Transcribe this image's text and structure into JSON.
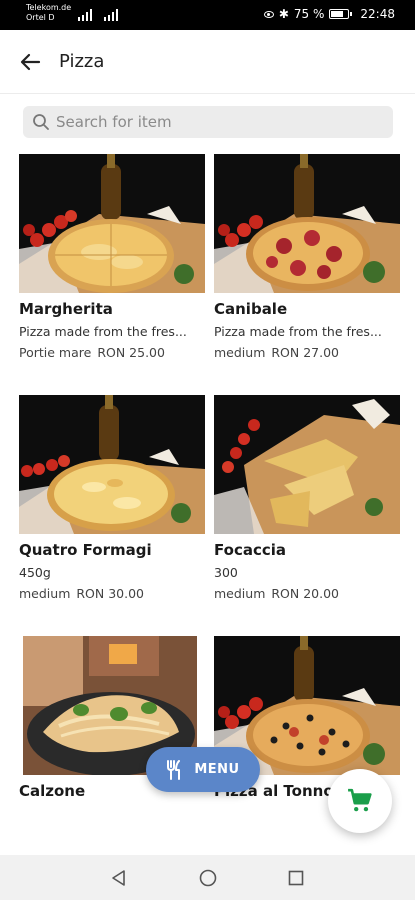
{
  "status_bar": {
    "carrier_line1": "Telekom.de",
    "carrier_line2": "Ortel D",
    "battery": "75 %",
    "time": "22:48"
  },
  "header": {
    "title": "Pizza",
    "back_icon": "arrow-left-icon"
  },
  "search": {
    "placeholder": "Search for item",
    "icon": "search-icon"
  },
  "items": [
    {
      "name": "Margherita",
      "description": "Pizza made from the fres...",
      "size": "Portie mare",
      "price": "RON 25.00"
    },
    {
      "name": "Canibale",
      "description": "Pizza made from the fres...",
      "size": "medium",
      "price": "RON 27.00"
    },
    {
      "name": "Quatro Formagi",
      "description": "450g",
      "size": "medium",
      "price": "RON 30.00"
    },
    {
      "name": "Focaccia",
      "description": "300",
      "size": "medium",
      "price": "RON 20.00"
    },
    {
      "name": "Calzone",
      "description": "",
      "size": "",
      "price": ""
    },
    {
      "name": "Pizza al Tonno",
      "description": "",
      "size": "",
      "price": ""
    }
  ],
  "menu_button": {
    "label": "MENU",
    "icon": "fork-knife-icon"
  },
  "cart_button": {
    "icon": "shopping-cart-icon",
    "color": "#1a9e4a"
  },
  "colors": {
    "accent": "#5b86c9",
    "cart_green": "#1a9e4a"
  },
  "nav": {
    "back_icon": "nav-back-icon",
    "home_icon": "nav-home-icon",
    "recents_icon": "nav-recents-icon"
  }
}
